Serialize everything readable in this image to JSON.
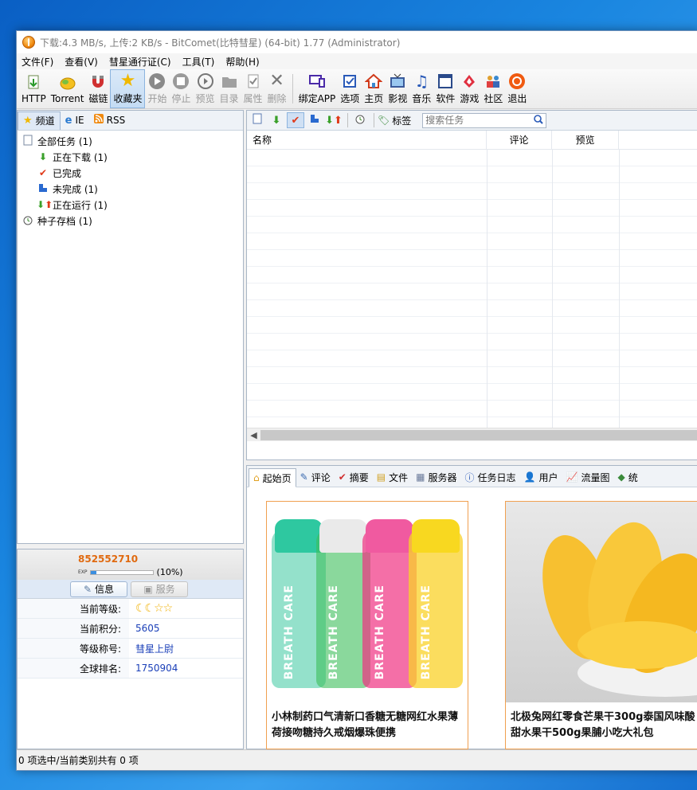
{
  "window": {
    "title": "下载:4.3 MB/s, 上传:2 KB/s - BitComet(比特彗星) (64-bit) 1.77 (Administrator)"
  },
  "menu": [
    "文件(F)",
    "查看(V)",
    "彗星通行证(C)",
    "工具(T)",
    "帮助(H)"
  ],
  "toolbar": [
    {
      "label": "HTTP",
      "icon": "http-download-icon",
      "disabled": false
    },
    {
      "label": "Torrent",
      "icon": "torrent-icon",
      "disabled": false
    },
    {
      "label": "磁链",
      "icon": "magnet-icon",
      "disabled": false
    },
    {
      "label": "收藏夹",
      "icon": "star-icon",
      "disabled": false
    },
    {
      "label": "开始",
      "icon": "play-icon",
      "disabled": true
    },
    {
      "label": "停止",
      "icon": "stop-icon",
      "disabled": true
    },
    {
      "label": "预览",
      "icon": "preview-icon",
      "disabled": true
    },
    {
      "label": "目录",
      "icon": "folder-icon",
      "disabled": true
    },
    {
      "label": "属性",
      "icon": "properties-icon",
      "disabled": true
    },
    {
      "label": "删除",
      "icon": "delete-icon",
      "disabled": true
    },
    {
      "label": "绑定APP",
      "icon": "bind-app-icon",
      "disabled": false
    },
    {
      "label": "选项",
      "icon": "options-icon",
      "disabled": false
    },
    {
      "label": "主页",
      "icon": "home-icon",
      "disabled": false
    },
    {
      "label": "影视",
      "icon": "video-icon",
      "disabled": false
    },
    {
      "label": "音乐",
      "icon": "music-icon",
      "disabled": false
    },
    {
      "label": "软件",
      "icon": "software-icon",
      "disabled": false
    },
    {
      "label": "游戏",
      "icon": "game-icon",
      "disabled": false
    },
    {
      "label": "社区",
      "icon": "community-icon",
      "disabled": false
    },
    {
      "label": "退出",
      "icon": "exit-icon",
      "disabled": false
    }
  ],
  "left_tabs": [
    "频道",
    "IE",
    "RSS"
  ],
  "tree": [
    {
      "label": "全部任务 (1)",
      "icon": "all-tasks-icon",
      "indent": 0
    },
    {
      "label": "正在下载 (1)",
      "icon": "downloading-icon",
      "indent": 1
    },
    {
      "label": "已完成",
      "icon": "completed-icon",
      "indent": 1
    },
    {
      "label": "未完成 (1)",
      "icon": "incomplete-icon",
      "indent": 1
    },
    {
      "label": "正在运行 (1)",
      "icon": "running-icon",
      "indent": 1
    },
    {
      "label": "种子存档 (1)",
      "icon": "torrent-archive-icon",
      "indent": 0
    }
  ],
  "user": {
    "id": "852552710",
    "exp_label": "EXP",
    "exp_percent": 10,
    "exp_text": "(10%)",
    "tabs": [
      "信息",
      "服务"
    ],
    "rows": [
      {
        "key": "当前等级:",
        "value": ""
      },
      {
        "key": "当前积分:",
        "value": "5605"
      },
      {
        "key": "等级称号:",
        "value": "彗星上尉"
      },
      {
        "key": "全球排名:",
        "value": "1750904"
      }
    ],
    "level_icons": "☾☾☆☆"
  },
  "task_toolbar": {
    "tag_label": "标签",
    "search_placeholder": "搜索任务"
  },
  "columns": [
    "名称",
    "评论",
    "预览"
  ],
  "bottom_tabs": [
    "起始页",
    "评论",
    "摘要",
    "文件",
    "服务器",
    "任务日志",
    "用户",
    "流量图",
    "统"
  ],
  "products": [
    {
      "title": "小林制药口气清新口香糖无糖网红水果薄荷接吻糖持久戒烟爆珠便携",
      "bottle_text": "BREATH CARE"
    },
    {
      "title": "北极兔网红零食芒果干300g泰国风味酸甜水果干500g果脯小吃大礼包"
    }
  ],
  "status": "0 项选中/当前类别共有 0 项"
}
